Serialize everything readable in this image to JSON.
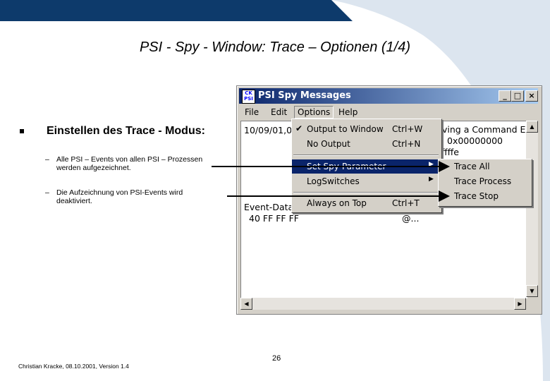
{
  "slide": {
    "title": "PSI - Spy - Window:  Trace – Optionen (1/4)",
    "bullet": "Einstellen des Trace - Modus:",
    "sub_items": [
      {
        "dash": "–",
        "text": "Alle PSI – Events von allen PSI – Prozessen werden aufgezeichnet."
      },
      {
        "dash": "–",
        "text": "Die Aufzeichnung von PSI-Events wird deaktiviert."
      }
    ],
    "footer": "Christian Kracke, 08.10.2001, Version 1.4",
    "page_number": "26"
  },
  "window": {
    "icon_text": "CK PSI",
    "title": "PSI Spy Messages",
    "buttons": {
      "minimize": "_",
      "maximize": "□",
      "close": "×"
    },
    "menu": [
      "File",
      "Edit",
      "Options",
      "Help"
    ],
    "content": {
      "line1": "10/09/01,0",
      "line_right1": "ving a Command Ev",
      "line_right2": "0x00000000",
      "line_right3": "ffffe",
      "event_label": "Event-Data",
      "event_values": "40 FF FF FF",
      "tail": "@..."
    },
    "dropdown": [
      {
        "label": "Output to Window",
        "shortcut": "Ctrl+W",
        "checked": "✔"
      },
      {
        "label": "No Output",
        "shortcut": "Ctrl+N"
      },
      {
        "label": "Set Spy-Parameter",
        "arrow": "▶"
      },
      {
        "label": "LogSwitches",
        "arrow": "▶"
      },
      {
        "label": "Always on Top",
        "shortcut": "Ctrl+T"
      }
    ],
    "submenu": [
      "Trace All",
      "Trace Process",
      "Trace Stop"
    ],
    "scroll": {
      "up": "▲",
      "down": "▼",
      "left": "◀",
      "right": "▶"
    }
  },
  "colors": {
    "accent_dark": "#0d3a6b",
    "accent_light": "#c8d7e8",
    "highlight": "#0a246a"
  }
}
